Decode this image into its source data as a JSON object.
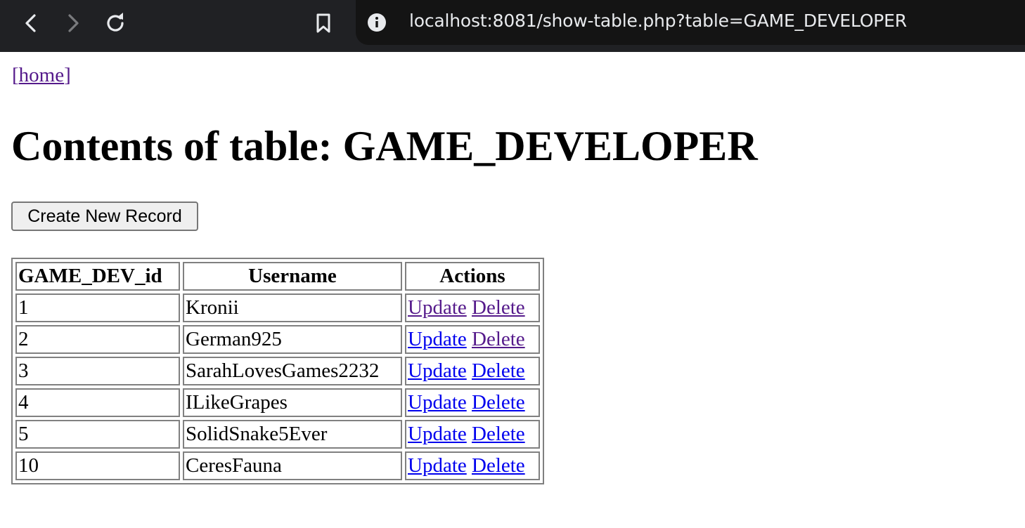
{
  "browser": {
    "url": "localhost:8081/show-table.php?table=GAME_DEVELOPER",
    "icons": {
      "back": "chevron-left-icon",
      "forward": "chevron-right-icon",
      "reload": "reload-icon",
      "bookmark": "bookmark-icon",
      "site_info": "info-icon"
    }
  },
  "page": {
    "home_open": "[",
    "home_label": "home",
    "home_close": "]",
    "title": "Contents of table: GAME_DEVELOPER",
    "create_button": "Create New Record"
  },
  "table": {
    "headers": [
      "GAME_DEV_id",
      "Username",
      "Actions"
    ],
    "update_label": "Update",
    "delete_label": "Delete",
    "rows": [
      {
        "id": "1",
        "username": "Kronii"
      },
      {
        "id": "2",
        "username": "German925"
      },
      {
        "id": "3",
        "username": "SarahLovesGames2232"
      },
      {
        "id": "4",
        "username": "ILikeGrapes"
      },
      {
        "id": "5",
        "username": "SolidSnake5Ever"
      },
      {
        "id": "10",
        "username": "CeresFauna"
      }
    ]
  },
  "colors": {
    "link": "#0000ee",
    "visited_link": "#551a8b",
    "chrome_bg": "#202124",
    "url_bg": "#141414"
  }
}
